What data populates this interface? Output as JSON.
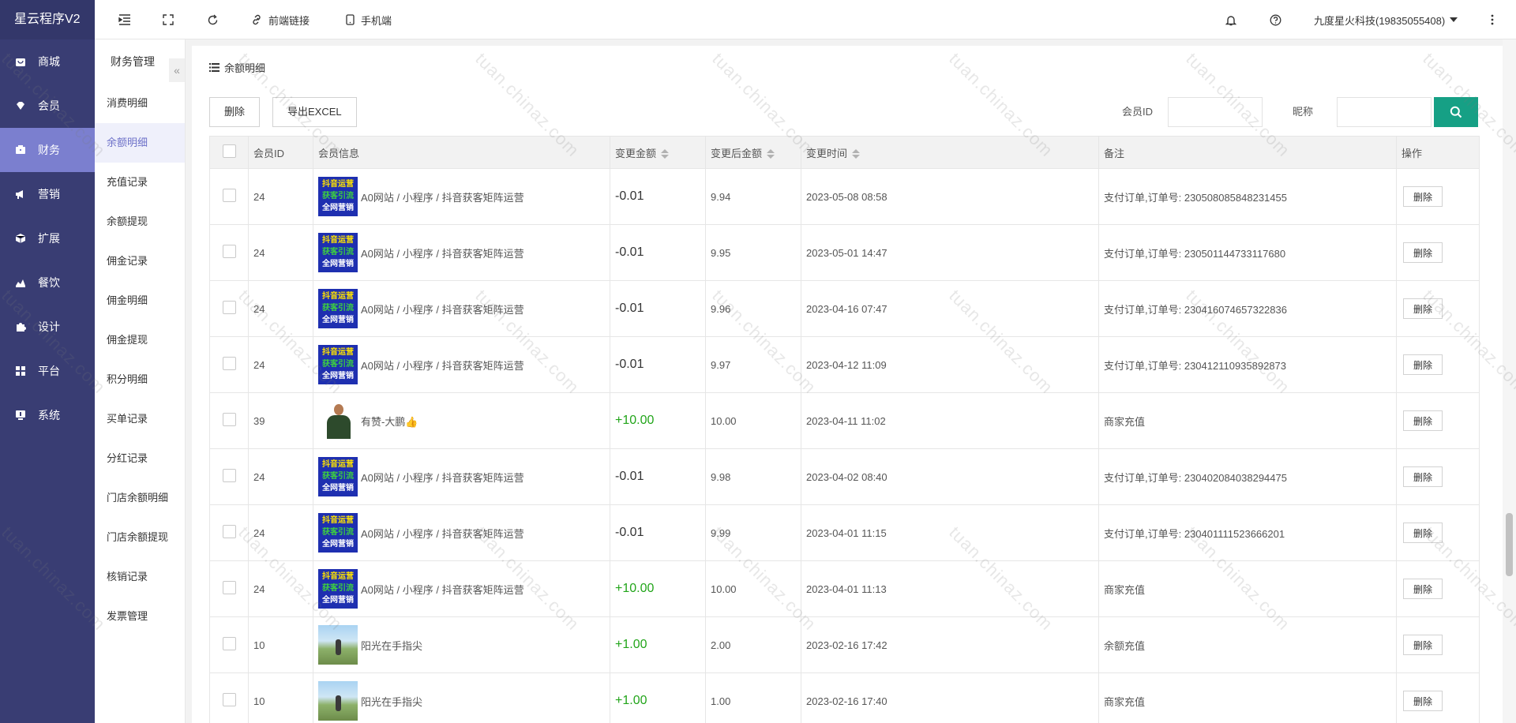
{
  "app": {
    "brand": "星云程序V2"
  },
  "sidebar": {
    "items": [
      {
        "label": "商城",
        "icon": "shop-icon"
      },
      {
        "label": "会员",
        "icon": "diamond-icon"
      },
      {
        "label": "财务",
        "icon": "wallet-icon",
        "active": true
      },
      {
        "label": "营销",
        "icon": "megaphone-icon"
      },
      {
        "label": "扩展",
        "icon": "cube-icon"
      },
      {
        "label": "餐饮",
        "icon": "cloud-icon"
      },
      {
        "label": "设计",
        "icon": "puzzle-icon"
      },
      {
        "label": "平台",
        "icon": "grid-icon"
      },
      {
        "label": "系统",
        "icon": "monitor-icon"
      }
    ]
  },
  "topbar": {
    "frontend_link": "前端链接",
    "mobile": "手机端",
    "user": "九度星火科技(19835055408)"
  },
  "submenu": {
    "title": "财务管理",
    "collapse": "«",
    "items": [
      {
        "label": "消费明细"
      },
      {
        "label": "余额明细",
        "active": true
      },
      {
        "label": "充值记录"
      },
      {
        "label": "余额提现"
      },
      {
        "label": "佣金记录"
      },
      {
        "label": "佣金明细"
      },
      {
        "label": "佣金提现"
      },
      {
        "label": "积分明细"
      },
      {
        "label": "买单记录"
      },
      {
        "label": "分红记录"
      },
      {
        "label": "门店余额明细"
      },
      {
        "label": "门店余额提现"
      },
      {
        "label": "核销记录"
      },
      {
        "label": "发票管理"
      }
    ]
  },
  "panel": {
    "title": "余额明细",
    "delete_label": "删除",
    "export_label": "导出EXCEL",
    "member_id_label": "会员ID",
    "member_id_value": "",
    "nickname_label": "昵称",
    "nickname_value": ""
  },
  "table": {
    "columns": [
      "会员ID",
      "会员信息",
      "变更金额",
      "变更后金额",
      "变更时间",
      "备注",
      "操作"
    ],
    "row_action": "删除",
    "rows": [
      {
        "id": "24",
        "avatar": "promo",
        "name": "A0网站 / 小程序 / 抖音获客矩阵运营",
        "amount": "-0.01",
        "positive": false,
        "after": "9.94",
        "time": "2023-05-08 08:58",
        "note": "支付订单,订单号: 230508085848231455"
      },
      {
        "id": "24",
        "avatar": "promo",
        "name": "A0网站 / 小程序 / 抖音获客矩阵运营",
        "amount": "-0.01",
        "positive": false,
        "after": "9.95",
        "time": "2023-05-01 14:47",
        "note": "支付订单,订单号: 230501144733117680"
      },
      {
        "id": "24",
        "avatar": "promo",
        "name": "A0网站 / 小程序 / 抖音获客矩阵运营",
        "amount": "-0.01",
        "positive": false,
        "after": "9.96",
        "time": "2023-04-16 07:47",
        "note": "支付订单,订单号: 230416074657322836"
      },
      {
        "id": "24",
        "avatar": "promo",
        "name": "A0网站 / 小程序 / 抖音获客矩阵运营",
        "amount": "-0.01",
        "positive": false,
        "after": "9.97",
        "time": "2023-04-12 11:09",
        "note": "支付订单,订单号: 230412110935892873"
      },
      {
        "id": "39",
        "avatar": "person",
        "name": "有赞-大鹏👍",
        "amount": "+10.00",
        "positive": true,
        "after": "10.00",
        "time": "2023-04-11 11:02",
        "note": "商家充值"
      },
      {
        "id": "24",
        "avatar": "promo",
        "name": "A0网站 / 小程序 / 抖音获客矩阵运营",
        "amount": "-0.01",
        "positive": false,
        "after": "9.98",
        "time": "2023-04-02 08:40",
        "note": "支付订单,订单号: 230402084038294475"
      },
      {
        "id": "24",
        "avatar": "promo",
        "name": "A0网站 / 小程序 / 抖音获客矩阵运营",
        "amount": "-0.01",
        "positive": false,
        "after": "9.99",
        "time": "2023-04-01 11:15",
        "note": "支付订单,订单号: 230401111523666201"
      },
      {
        "id": "24",
        "avatar": "promo",
        "name": "A0网站 / 小程序 / 抖音获客矩阵运营",
        "amount": "+10.00",
        "positive": true,
        "after": "10.00",
        "time": "2023-04-01 11:13",
        "note": "商家充值"
      },
      {
        "id": "10",
        "avatar": "landscape",
        "name": "阳光在手指尖",
        "amount": "+1.00",
        "positive": true,
        "after": "2.00",
        "time": "2023-02-16 17:42",
        "note": "余额充值"
      },
      {
        "id": "10",
        "avatar": "landscape",
        "name": "阳光在手指尖",
        "amount": "+1.00",
        "positive": true,
        "after": "1.00",
        "time": "2023-02-16 17:40",
        "note": "商家充值"
      }
    ]
  },
  "promo_avatar": {
    "line1": "抖音运营",
    "line2": "获客引流",
    "line3": "全网营销"
  },
  "watermark": "tuan.chinaz.com",
  "colors": {
    "sidebar": "#393d73",
    "active_nav": "#7b7fcf",
    "accent": "#16a085",
    "positive": "#22a51a"
  }
}
